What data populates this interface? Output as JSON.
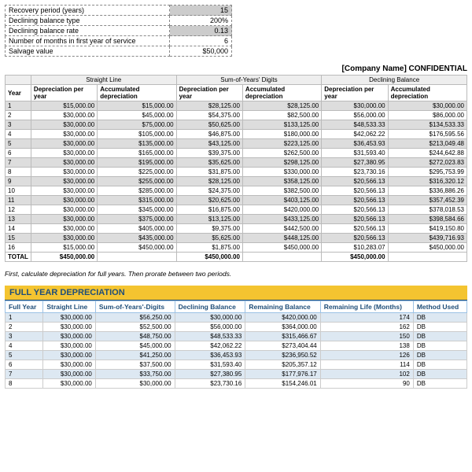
{
  "params": [
    {
      "label": "Recovery period (years)",
      "value": "15",
      "shade": true
    },
    {
      "label": "Declining balance type",
      "value": "200%",
      "shade": false
    },
    {
      "label": "Declining balance rate",
      "value": "0.13",
      "shade": true
    },
    {
      "label": "Number of months in first year of service",
      "value": "6",
      "shade": false
    },
    {
      "label": "Salvage value",
      "value": "$50,000",
      "shade": false
    }
  ],
  "confidential": "[Company Name]  CONFIDENTIAL",
  "main_headers_groups": [
    "",
    "Straight Line",
    "Sum-of-Years' Digits",
    "Declining Balance"
  ],
  "main_headers_cols": [
    "Year",
    "Depreciation per year",
    "Accumulated depreciation",
    "Depreciation per year",
    "Accumulated depreciation",
    "Depreciation per year",
    "Accumulated depreciation"
  ],
  "main_rows": [
    {
      "y": "1",
      "sl_d": "$15,000.00",
      "sl_a": "$15,000.00",
      "sy_d": "$28,125.00",
      "sy_a": "$28,125.00",
      "db_d": "$30,000.00",
      "db_a": "$30,000.00"
    },
    {
      "y": "2",
      "sl_d": "$30,000.00",
      "sl_a": "$45,000.00",
      "sy_d": "$54,375.00",
      "sy_a": "$82,500.00",
      "db_d": "$56,000.00",
      "db_a": "$86,000.00"
    },
    {
      "y": "3",
      "sl_d": "$30,000.00",
      "sl_a": "$75,000.00",
      "sy_d": "$50,625.00",
      "sy_a": "$133,125.00",
      "db_d": "$48,533.33",
      "db_a": "$134,533.33"
    },
    {
      "y": "4",
      "sl_d": "$30,000.00",
      "sl_a": "$105,000.00",
      "sy_d": "$46,875.00",
      "sy_a": "$180,000.00",
      "db_d": "$42,062.22",
      "db_a": "$176,595.56"
    },
    {
      "y": "5",
      "sl_d": "$30,000.00",
      "sl_a": "$135,000.00",
      "sy_d": "$43,125.00",
      "sy_a": "$223,125.00",
      "db_d": "$36,453.93",
      "db_a": "$213,049.48"
    },
    {
      "y": "6",
      "sl_d": "$30,000.00",
      "sl_a": "$165,000.00",
      "sy_d": "$39,375.00",
      "sy_a": "$262,500.00",
      "db_d": "$31,593.40",
      "db_a": "$244,642.88"
    },
    {
      "y": "7",
      "sl_d": "$30,000.00",
      "sl_a": "$195,000.00",
      "sy_d": "$35,625.00",
      "sy_a": "$298,125.00",
      "db_d": "$27,380.95",
      "db_a": "$272,023.83"
    },
    {
      "y": "8",
      "sl_d": "$30,000.00",
      "sl_a": "$225,000.00",
      "sy_d": "$31,875.00",
      "sy_a": "$330,000.00",
      "db_d": "$23,730.16",
      "db_a": "$295,753.99"
    },
    {
      "y": "9",
      "sl_d": "$30,000.00",
      "sl_a": "$255,000.00",
      "sy_d": "$28,125.00",
      "sy_a": "$358,125.00",
      "db_d": "$20,566.13",
      "db_a": "$316,320.12"
    },
    {
      "y": "10",
      "sl_d": "$30,000.00",
      "sl_a": "$285,000.00",
      "sy_d": "$24,375.00",
      "sy_a": "$382,500.00",
      "db_d": "$20,566.13",
      "db_a": "$336,886.26"
    },
    {
      "y": "11",
      "sl_d": "$30,000.00",
      "sl_a": "$315,000.00",
      "sy_d": "$20,625.00",
      "sy_a": "$403,125.00",
      "db_d": "$20,566.13",
      "db_a": "$357,452.39"
    },
    {
      "y": "12",
      "sl_d": "$30,000.00",
      "sl_a": "$345,000.00",
      "sy_d": "$16,875.00",
      "sy_a": "$420,000.00",
      "db_d": "$20,566.13",
      "db_a": "$378,018.53"
    },
    {
      "y": "13",
      "sl_d": "$30,000.00",
      "sl_a": "$375,000.00",
      "sy_d": "$13,125.00",
      "sy_a": "$433,125.00",
      "db_d": "$20,566.13",
      "db_a": "$398,584.66"
    },
    {
      "y": "14",
      "sl_d": "$30,000.00",
      "sl_a": "$405,000.00",
      "sy_d": "$9,375.00",
      "sy_a": "$442,500.00",
      "db_d": "$20,566.13",
      "db_a": "$419,150.80"
    },
    {
      "y": "15",
      "sl_d": "$30,000.00",
      "sl_a": "$435,000.00",
      "sy_d": "$5,625.00",
      "sy_a": "$448,125.00",
      "db_d": "$20,566.13",
      "db_a": "$439,716.93"
    },
    {
      "y": "16",
      "sl_d": "$15,000.00",
      "sl_a": "$450,000.00",
      "sy_d": "$1,875.00",
      "sy_a": "$450,000.00",
      "db_d": "$10,283.07",
      "db_a": "$450,000.00"
    }
  ],
  "main_total": {
    "label": "TOTAL",
    "sl": "$450,000.00",
    "sy": "$450,000.00",
    "db": "$450,000.00"
  },
  "note": "First, calculate depreciation for full years.  Then prorate between two periods.",
  "section_title": "FULL YEAR DEPRECIATION",
  "full_headers": [
    "Full Year",
    "Straight Line",
    "Sum-of-Years'-Digits",
    "Declining Balance",
    "Remaining Balance",
    "Remaining Life (Months)",
    "Method Used"
  ],
  "full_rows": [
    {
      "y": "1",
      "sl": "$30,000.00",
      "sy": "$56,250.00",
      "db": "$30,000.00",
      "rb": "$420,000.00",
      "rl": "174",
      "m": "DB"
    },
    {
      "y": "2",
      "sl": "$30,000.00",
      "sy": "$52,500.00",
      "db": "$56,000.00",
      "rb": "$364,000.00",
      "rl": "162",
      "m": "DB"
    },
    {
      "y": "3",
      "sl": "$30,000.00",
      "sy": "$48,750.00",
      "db": "$48,533.33",
      "rb": "$315,466.67",
      "rl": "150",
      "m": "DB"
    },
    {
      "y": "4",
      "sl": "$30,000.00",
      "sy": "$45,000.00",
      "db": "$42,062.22",
      "rb": "$273,404.44",
      "rl": "138",
      "m": "DB"
    },
    {
      "y": "5",
      "sl": "$30,000.00",
      "sy": "$41,250.00",
      "db": "$36,453.93",
      "rb": "$236,950.52",
      "rl": "126",
      "m": "DB"
    },
    {
      "y": "6",
      "sl": "$30,000.00",
      "sy": "$37,500.00",
      "db": "$31,593.40",
      "rb": "$205,357.12",
      "rl": "114",
      "m": "DB"
    },
    {
      "y": "7",
      "sl": "$30,000.00",
      "sy": "$33,750.00",
      "db": "$27,380.95",
      "rb": "$177,976.17",
      "rl": "102",
      "m": "DB"
    },
    {
      "y": "8",
      "sl": "$30,000.00",
      "sy": "$30,000.00",
      "db": "$23,730.16",
      "rb": "$154,246.01",
      "rl": "90",
      "m": "DB"
    }
  ]
}
